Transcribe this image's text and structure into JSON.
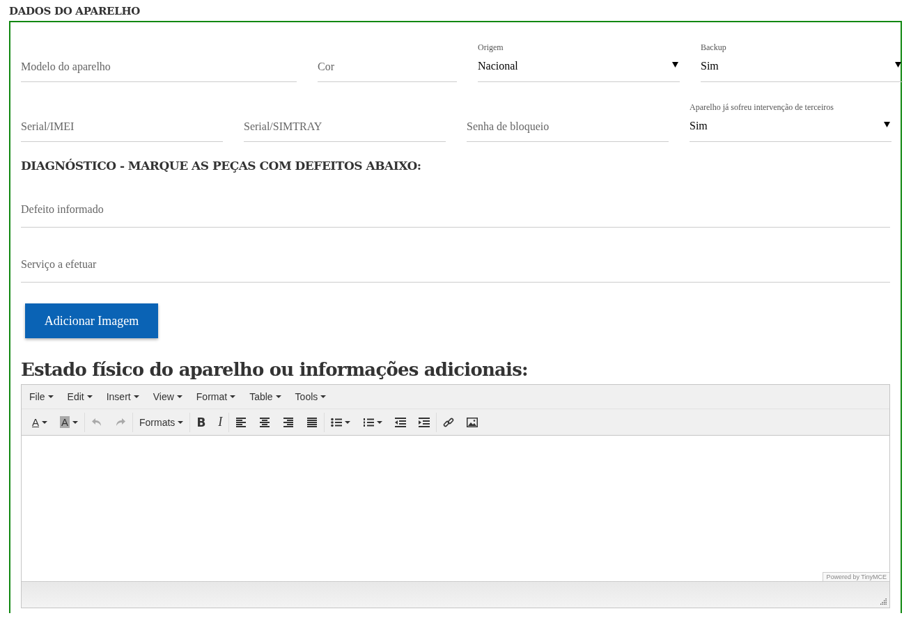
{
  "section_title": "DADOS DO APARELHO",
  "field_rows": [
    [
      {
        "kind": "input",
        "placeholder": "Modelo do aparelho"
      },
      {
        "kind": "input",
        "placeholder": "Cor"
      },
      {
        "kind": "select",
        "label": "Origem",
        "value": "Nacional"
      },
      {
        "kind": "select",
        "label": "Backup",
        "value": "Sim"
      }
    ],
    [
      {
        "kind": "input",
        "placeholder": "Serial/IMEI"
      },
      {
        "kind": "input",
        "placeholder": "Serial/SIMTRAY"
      },
      {
        "kind": "input",
        "placeholder": "Senha de bloqueio"
      },
      {
        "kind": "select",
        "label": "Aparelho já sofreu intervenção de terceiros",
        "value": "Sim"
      }
    ]
  ],
  "diagnosis_title": "DIAGNÓSTICO - MARQUE AS PEÇAS COM DEFEITOS ABAIXO:",
  "wide_fields": [
    {
      "placeholder": "Defeito informado"
    },
    {
      "placeholder": "Serviço a efetuar"
    }
  ],
  "add_image_button": "Adicionar Imagem",
  "editor_title": "Estado físico do aparelho ou informações adicionais:",
  "editor": {
    "menus": [
      "File",
      "Edit",
      "Insert",
      "View",
      "Format",
      "Table",
      "Tools"
    ],
    "toolbar": [
      {
        "kind": "text-color",
        "glyph": "A",
        "disabled": false,
        "dropdown": true
      },
      {
        "kind": "bg-color",
        "glyph": "A",
        "disabled": false,
        "dropdown": true,
        "group_end": true
      },
      {
        "kind": "undo",
        "disabled": true
      },
      {
        "kind": "redo",
        "disabled": true,
        "group_end": true
      },
      {
        "kind": "formats",
        "label": "Formats",
        "disabled": false,
        "dropdown": true,
        "group_end": true
      },
      {
        "kind": "bold",
        "glyph": "B",
        "disabled": false
      },
      {
        "kind": "italic",
        "glyph": "I",
        "disabled": false,
        "group_end": true
      },
      {
        "kind": "align-left",
        "disabled": false
      },
      {
        "kind": "align-center",
        "disabled": false
      },
      {
        "kind": "align-right",
        "disabled": false
      },
      {
        "kind": "align-justify",
        "disabled": false,
        "group_end": true
      },
      {
        "kind": "bullet-list",
        "disabled": false,
        "dropdown": true
      },
      {
        "kind": "numbered-list",
        "disabled": false,
        "dropdown": true
      },
      {
        "kind": "outdent",
        "disabled": false
      },
      {
        "kind": "indent",
        "disabled": false,
        "group_end": true
      },
      {
        "kind": "link",
        "disabled": false
      },
      {
        "kind": "image",
        "disabled": false
      }
    ],
    "branding": "Powered by TinyMCE"
  }
}
